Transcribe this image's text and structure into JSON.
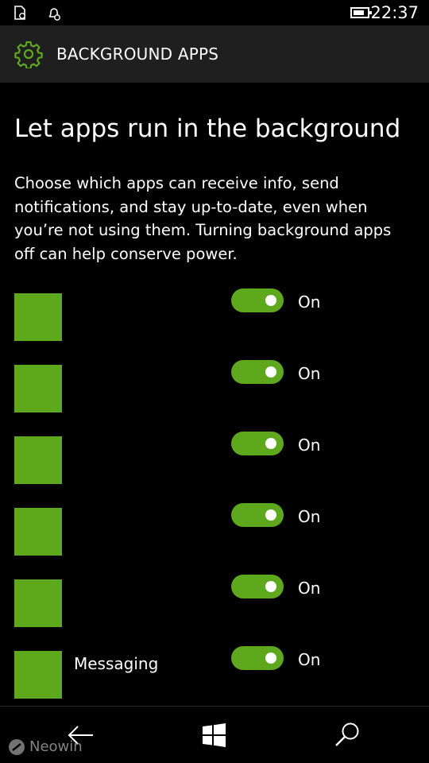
{
  "status_bar": {
    "time": "22:37",
    "icons": [
      "notification-icon",
      "silent-icon",
      "battery-icon"
    ]
  },
  "header": {
    "icon": "gear-icon",
    "title": "BACKGROUND APPS"
  },
  "content": {
    "title": "Let apps run in the background",
    "description": "Choose which apps can receive info, send notifications, and stay up-to-date, even when you’re not using them. Turning background apps off can help conserve power."
  },
  "apps": [
    {
      "name": "",
      "toggle_label": "On",
      "enabled": true
    },
    {
      "name": "",
      "toggle_label": "On",
      "enabled": true
    },
    {
      "name": "",
      "toggle_label": "On",
      "enabled": true
    },
    {
      "name": "",
      "toggle_label": "On",
      "enabled": true
    },
    {
      "name": "",
      "toggle_label": "On",
      "enabled": true
    },
    {
      "name": "Messaging",
      "toggle_label": "On",
      "enabled": true
    }
  ],
  "nav_bar": {
    "buttons": [
      "back-arrow-icon",
      "windows-logo-icon",
      "search-icon"
    ]
  },
  "watermark": {
    "text": "Neowin"
  },
  "colors": {
    "accent": "#5ea81e",
    "background": "#000000",
    "header_background": "#1f1f1f",
    "text": "#ffffff"
  }
}
